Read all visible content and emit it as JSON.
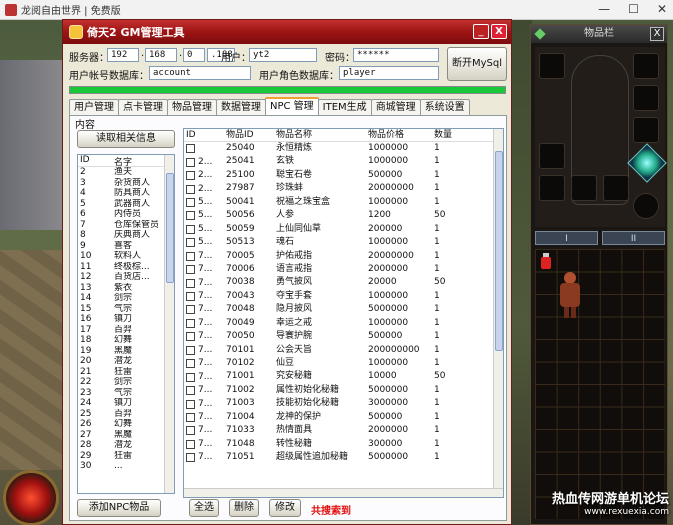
{
  "host": {
    "title": "龙阅自由世界 | 免费版"
  },
  "window": {
    "title": "倚天2 GM管理工具",
    "min_glyph": "_",
    "close_glyph": "X"
  },
  "conn": {
    "server_label": "服务器：",
    "ip": [
      "192",
      "168",
      "0",
      ".188"
    ],
    "user_label": "用户：",
    "user": "yt2",
    "pwd_label": "密码：",
    "pwd": "******",
    "acctdb_label": "用户帐号数据库：",
    "acctdb": "account",
    "roledb_label": "用户角色数据库：",
    "roledb": "player",
    "disconnect_label": "断开MySql",
    "progress": 1.0
  },
  "tabs": [
    "用户管理",
    "点卡管理",
    "物品管理",
    "数据管理",
    "NPC 管理",
    "ITEM生成",
    "商城管理",
    "系统设置"
  ],
  "active_tab": "NPC 管理",
  "content": {
    "group_label": "内容",
    "read_button": "读取相关信息",
    "npc_headers": [
      "ID",
      "名字"
    ],
    "npcs": [
      [
        "2",
        "渔夫"
      ],
      [
        "3",
        "杂货商人"
      ],
      [
        "4",
        "防具商人"
      ],
      [
        "5",
        "武器商人"
      ],
      [
        "6",
        "内侍员"
      ],
      [
        "7",
        "仓库保管员"
      ],
      [
        "8",
        "庆典商人"
      ],
      [
        "9",
        "喜客"
      ],
      [
        "10",
        "软料人"
      ],
      [
        "11",
        "终极棕..."
      ],
      [
        "12",
        "百货店..."
      ],
      [
        "13",
        "紫衣"
      ],
      [
        "14",
        "剑宗"
      ],
      [
        "15",
        "气宗"
      ],
      [
        "16",
        "镇刀"
      ],
      [
        "17",
        "百羿"
      ],
      [
        "18",
        "幻舞"
      ],
      [
        "19",
        "黑魔"
      ],
      [
        "20",
        "潜龙"
      ],
      [
        "21",
        "狂雷"
      ],
      [
        "22",
        "剑宗"
      ],
      [
        "23",
        "气宗"
      ],
      [
        "24",
        "镇刀"
      ],
      [
        "25",
        "百羿"
      ],
      [
        "26",
        "幻舞"
      ],
      [
        "27",
        "黑魔"
      ],
      [
        "28",
        "潜龙"
      ],
      [
        "29",
        "狂雷"
      ],
      [
        "30",
        "..."
      ]
    ],
    "item_headers": [
      "ID",
      "物品ID",
      "物品名称",
      "物品价格",
      "数量"
    ],
    "items": [
      [
        "",
        "25040",
        "永恒精炼",
        "1000000",
        "1"
      ],
      [
        "2...",
        "25041",
        "玄铁",
        "1000000",
        "1"
      ],
      [
        "2...",
        "25100",
        "聪宝石卷",
        "500000",
        "1"
      ],
      [
        "2...",
        "27987",
        "珍珠蚌",
        "20000000",
        "1"
      ],
      [
        "5...",
        "50041",
        "祝福之珠宝盒",
        "1000000",
        "1"
      ],
      [
        "5...",
        "50056",
        "人参",
        "1200",
        "50"
      ],
      [
        "5...",
        "50059",
        "上仙同仙草",
        "200000",
        "1"
      ],
      [
        "5...",
        "50513",
        "魂石",
        "1000000",
        "1"
      ],
      [
        "7...",
        "70005",
        "护佑戒指",
        "20000000",
        "1"
      ],
      [
        "7...",
        "70006",
        "语言戒指",
        "2000000",
        "1"
      ],
      [
        "7...",
        "70038",
        "勇气披风",
        "20000",
        "50"
      ],
      [
        "7...",
        "70043",
        "夺宝手套",
        "1000000",
        "1"
      ],
      [
        "7...",
        "70048",
        "隐月披风",
        "5000000",
        "1"
      ],
      [
        "7...",
        "70049",
        "幸运之戒",
        "1000000",
        "1"
      ],
      [
        "7...",
        "70050",
        "导寰护腕",
        "500000",
        "1"
      ],
      [
        "7...",
        "70101",
        "公会天旨",
        "200000000",
        "1"
      ],
      [
        "7...",
        "70102",
        "仙豆",
        "1000000",
        "1"
      ],
      [
        "7...",
        "71001",
        "究安秘籍",
        "10000",
        "50"
      ],
      [
        "7...",
        "71002",
        "属性初始化秘籍",
        "5000000",
        "1"
      ],
      [
        "7...",
        "71003",
        "技能初始化秘籍",
        "3000000",
        "1"
      ],
      [
        "7...",
        "71004",
        "龙神的保护",
        "500000",
        "1"
      ],
      [
        "7...",
        "71033",
        "热情面具",
        "2000000",
        "1"
      ],
      [
        "7...",
        "71048",
        "转性秘籍",
        "300000",
        "1"
      ],
      [
        "7...",
        "71051",
        "超级属性追加秘籍",
        "5000000",
        "1"
      ]
    ],
    "add_npc_button": "添加NPC物品",
    "select_all_button": "全选",
    "delete_button": "删除",
    "modify_button": "修改",
    "count_text": "共搜索到"
  },
  "inventory": {
    "title": "物品栏",
    "close_glyph": "X",
    "tabs": [
      "I",
      "II"
    ]
  },
  "watermark": {
    "line1": "热血传网游单机论坛",
    "line2": "www.rexuexia.com"
  }
}
